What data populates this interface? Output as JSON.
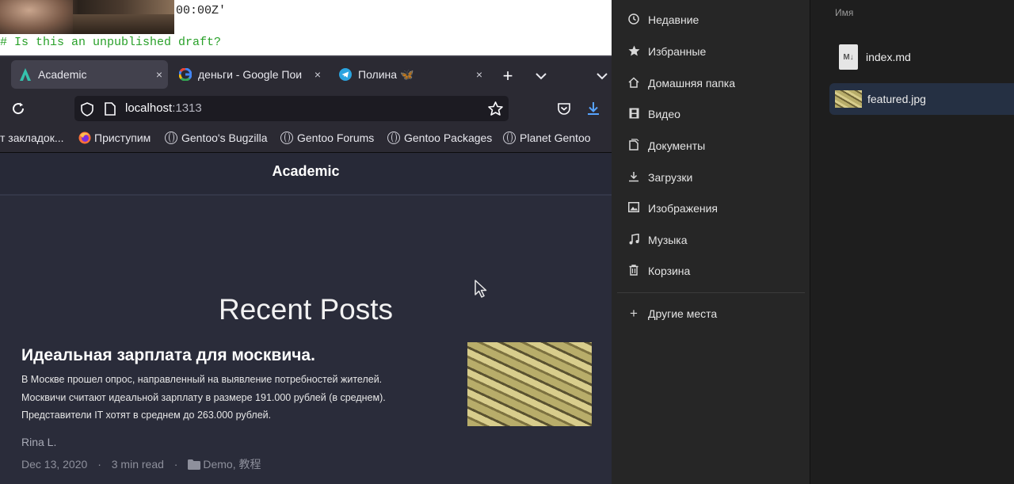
{
  "terminal": {
    "line1": "00:00Z'",
    "line2": "# Is this an unpublished draft?"
  },
  "browser": {
    "tabs": [
      {
        "label": "Academic",
        "icon": "academic-icon",
        "active": true
      },
      {
        "label": "деньги - Google Пои",
        "icon": "google-icon",
        "active": false
      },
      {
        "label": "Полина 🦋",
        "icon": "telegram-icon",
        "active": false
      }
    ],
    "close_glyph": "×",
    "new_tab_glyph": "+",
    "url_host": "localhost",
    "url_port": ":1313",
    "bookmarks": [
      {
        "label": "т закладок...",
        "icon": "folder-icon"
      },
      {
        "label": "Приступим",
        "icon": "firefox-icon"
      },
      {
        "label": "Gentoo's Bugzilla",
        "icon": "globe-icon"
      },
      {
        "label": "Gentoo Forums",
        "icon": "globe-icon"
      },
      {
        "label": "Gentoo Packages",
        "icon": "globe-icon"
      },
      {
        "label": "Planet Gentoo",
        "icon": "globe-icon"
      }
    ]
  },
  "page": {
    "site_title": "Academic",
    "section_title": "Recent Posts",
    "post": {
      "title": "Идеальная зарплата для москвича.",
      "summary_lines": [
        "В Москве прошел опрос, направленный на выявление потребностей жителей.",
        "Москвичи считают идеальной зарплату в размере 191.000 рублей (в среднем).",
        "Представители IT хотят в среднем до 263.000 рублей."
      ],
      "author": "Rina L.",
      "date": "Dec 13, 2020",
      "read_time": "3 min read",
      "sep": "·",
      "categories": "Demo, 教程"
    }
  },
  "file_manager": {
    "places": [
      {
        "label": "Недавние",
        "icon": "clock-icon"
      },
      {
        "label": "Избранные",
        "icon": "star-icon"
      },
      {
        "label": "Домашняя папка",
        "icon": "home-icon"
      },
      {
        "label": "Видео",
        "icon": "video-icon"
      },
      {
        "label": "Документы",
        "icon": "document-icon"
      },
      {
        "label": "Загрузки",
        "icon": "download-icon"
      },
      {
        "label": "Изображения",
        "icon": "image-icon"
      },
      {
        "label": "Музыка",
        "icon": "music-icon"
      },
      {
        "label": "Корзина",
        "icon": "trash-icon"
      }
    ],
    "other_places": "Другие места",
    "column_header": "Имя",
    "files": [
      {
        "name": "index.md",
        "icon": "markdown-file-icon",
        "selected": false
      },
      {
        "name": "featured.jpg",
        "icon": "image-file-icon",
        "selected": true
      }
    ],
    "md_icon_text": "M↓"
  },
  "colors": {
    "browser_chrome": "#2b2a33",
    "page_bg": "#2a2c3a",
    "sidebar_bg": "#262626",
    "selection": "#253043",
    "terminal_green": "#2aa12a",
    "download_blue": "#57a3ff"
  }
}
